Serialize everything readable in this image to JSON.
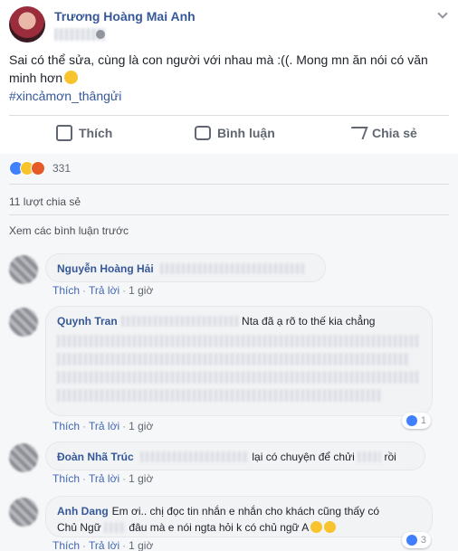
{
  "post": {
    "author": "Trương Hoàng Mai Anh",
    "text_line1": "Sai có thể sửa, cùng là con người với nhau mà :((. Mong mn ăn nói có văn",
    "text_line2": "minh hơn",
    "hashtag": "#xincảmơn_thângửi"
  },
  "actions": {
    "like": "Thích",
    "comment": "Bình luận",
    "share": "Chia sẻ"
  },
  "stats": {
    "reaction_count": "331",
    "shares": "11 lượt chia sẻ",
    "prev_comments": "Xem các bình luận trước"
  },
  "comment_actions": {
    "like": "Thích",
    "reply": "Trả lời",
    "time": "1 giờ"
  },
  "comments": [
    {
      "name": "Nguyễn Hoàng Hải",
      "text": ""
    },
    {
      "name": "Quynh Tran",
      "text": "Nta đã ạ rõ to thế kia chẳng",
      "likes": "1"
    },
    {
      "name": "Đoàn Nhã Trúc",
      "text_a": "lại có chuyện để chửi",
      "text_b": "rồi"
    },
    {
      "name": "Anh Dang",
      "text_a": "Em ơi.. chị đọc tin nhắn e nhắn cho khách cũng thấy có",
      "text_b": "Chủ Ngữ",
      "text_c": "đâu mà e nói ngta hỏi k có chủ ngữ A",
      "likes": "3"
    }
  ],
  "icons": [
    "globe-icon",
    "chevron-down-icon",
    "like-icon",
    "comment-icon",
    "share-icon"
  ],
  "colors": {
    "link": "#365899",
    "muted": "#606770",
    "like_blue": "#4080ff"
  }
}
